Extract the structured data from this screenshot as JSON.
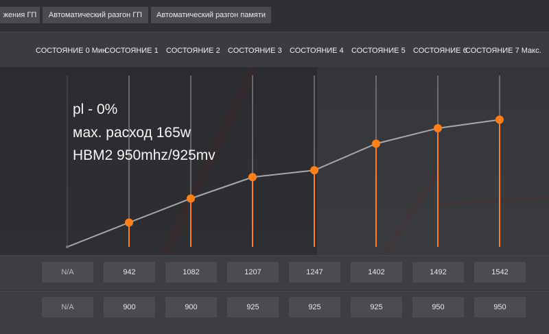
{
  "tabs": [
    {
      "label": "жения ГП"
    },
    {
      "label": "Автоматический разгон ГП"
    },
    {
      "label": "Автоматический разгон памяти"
    }
  ],
  "states": [
    "СОСТОЯНИЕ 0 Мин",
    "СОСТОЯНИЕ 1",
    "СОСТОЯНИЕ 2",
    "СОСТОЯНИЕ 3",
    "СОСТОЯНИЕ 4",
    "СОСТОЯНИЕ 5",
    "СОСТОЯНИЕ 6",
    "СОСТОЯНИЕ 7 Макс."
  ],
  "annotation": {
    "line1": "pl - 0%",
    "line2": "мах. расход 165w",
    "line3": "HBM2 950mhz/925mv"
  },
  "frequency_row": [
    "N/A",
    "942",
    "1082",
    "1207",
    "1247",
    "1402",
    "1492",
    "1542"
  ],
  "voltage_row": [
    "N/A",
    "900",
    "900",
    "925",
    "925",
    "925",
    "950",
    "950"
  ],
  "curve": {
    "values": [
      null,
      942,
      1082,
      1207,
      1247,
      1402,
      1492,
      1542
    ],
    "min": 800,
    "max": 1800
  },
  "colors": {
    "accent": "#ff7f1a",
    "line": "#a9a9a9"
  }
}
